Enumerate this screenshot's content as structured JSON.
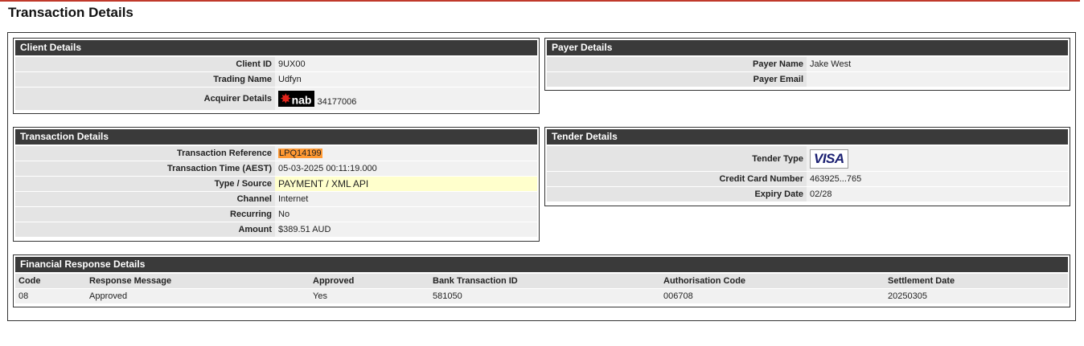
{
  "page": {
    "title": "Transaction Details"
  },
  "client": {
    "title": "Client Details",
    "rows": [
      {
        "label": "Client ID",
        "value": "9UX00"
      },
      {
        "label": "Trading Name",
        "value": "Udfyn"
      },
      {
        "label": "Acquirer Details",
        "logo_text": "nab",
        "logo_icon": "nab-star-logo",
        "value": "34177006"
      }
    ]
  },
  "payer": {
    "title": "Payer Details",
    "rows": [
      {
        "label": "Payer Name",
        "value": "Jake West"
      },
      {
        "label": "Payer Email",
        "value": ""
      }
    ]
  },
  "transaction": {
    "title": "Transaction Details",
    "rows": [
      {
        "label": "Transaction Reference",
        "value": "LPQ14199"
      },
      {
        "label": "Transaction Time (AEST)",
        "value": "05-03-2025 00:11:19.000"
      },
      {
        "label": "Type / Source",
        "value": "PAYMENT / XML API"
      },
      {
        "label": "Channel",
        "value": "Internet"
      },
      {
        "label": "Recurring",
        "value": "No"
      },
      {
        "label": "Amount",
        "value": "$389.51 AUD"
      }
    ],
    "colors": {
      "reference_highlight": "#ff9933",
      "type_highlight": "#ffffcc"
    }
  },
  "tender": {
    "title": "Tender Details",
    "rows": [
      {
        "label": "Tender Type",
        "logo_text": "VISA",
        "logo_icon": "visa-logo"
      },
      {
        "label": "Credit Card Number",
        "value": "463925...765"
      },
      {
        "label": "Expiry Date",
        "value": "02/28"
      }
    ]
  },
  "financial": {
    "title": "Financial Response Details",
    "columns": [
      "Code",
      "Response Message",
      "Approved",
      "Bank Transaction ID",
      "Authorisation Code",
      "Settlement Date"
    ],
    "rows": [
      [
        "08",
        "Approved",
        "Yes",
        "581050",
        "006708",
        "20250305"
      ]
    ]
  },
  "theme": {
    "header_bg": "#3a3a3a",
    "accent_line": "#c0392b",
    "label_bg": "#e4e4e4",
    "value_bg": "#f1f1f1"
  }
}
